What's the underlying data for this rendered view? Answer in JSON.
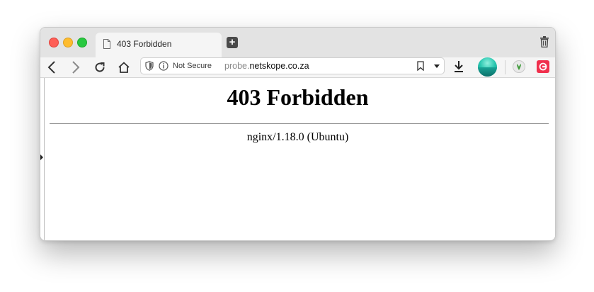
{
  "tab": {
    "title": "403 Forbidden",
    "icon": "page-icon"
  },
  "toolbar": {
    "back_icon": "back-arrow-icon",
    "forward_icon": "forward-arrow-icon",
    "reload_icon": "reload-icon",
    "home_icon": "home-icon",
    "download_icon": "download-icon"
  },
  "urlbar": {
    "security_label": "Not Secure",
    "url_subdomain": "probe.",
    "url_domain": "netskope.co.za"
  },
  "page": {
    "heading": "403 Forbidden",
    "server": "nginx/1.18.0 (Ubuntu)"
  },
  "colors": {
    "close": "#fe5f57",
    "minimize": "#febc2e",
    "zoom": "#28c840",
    "extension_red": "#f0304d",
    "avatar_teal": "#29c7b0"
  }
}
